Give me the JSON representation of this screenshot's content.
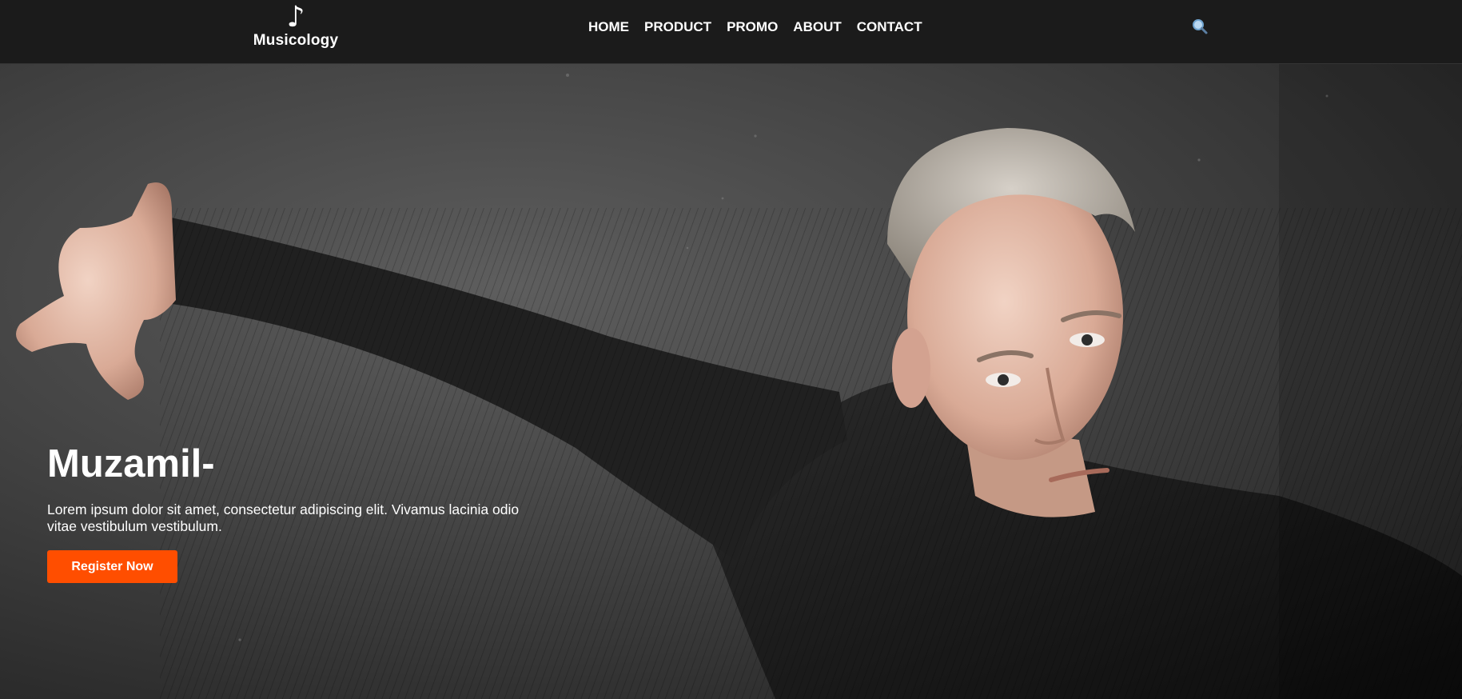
{
  "navbar": {
    "logo_text": "Musicology",
    "logo_icon": "music-note-icon",
    "links": [
      "HOME",
      "PRODUCT",
      "PROMO",
      "ABOUT",
      "CONTACT"
    ],
    "search_icon": "search-icon"
  },
  "hero": {
    "title": "Muzamil-",
    "description": "Lorem ipsum dolor sit amet, consectetur adipiscing elit. Vivamus lacinia odio vitae vestibulum vestibulum.",
    "cta_label": "Register Now",
    "image": "dancer-photo"
  },
  "colors": {
    "navbar_bg": "#1b1b1b",
    "accent": "#ff4e00",
    "text": "#ffffff"
  }
}
